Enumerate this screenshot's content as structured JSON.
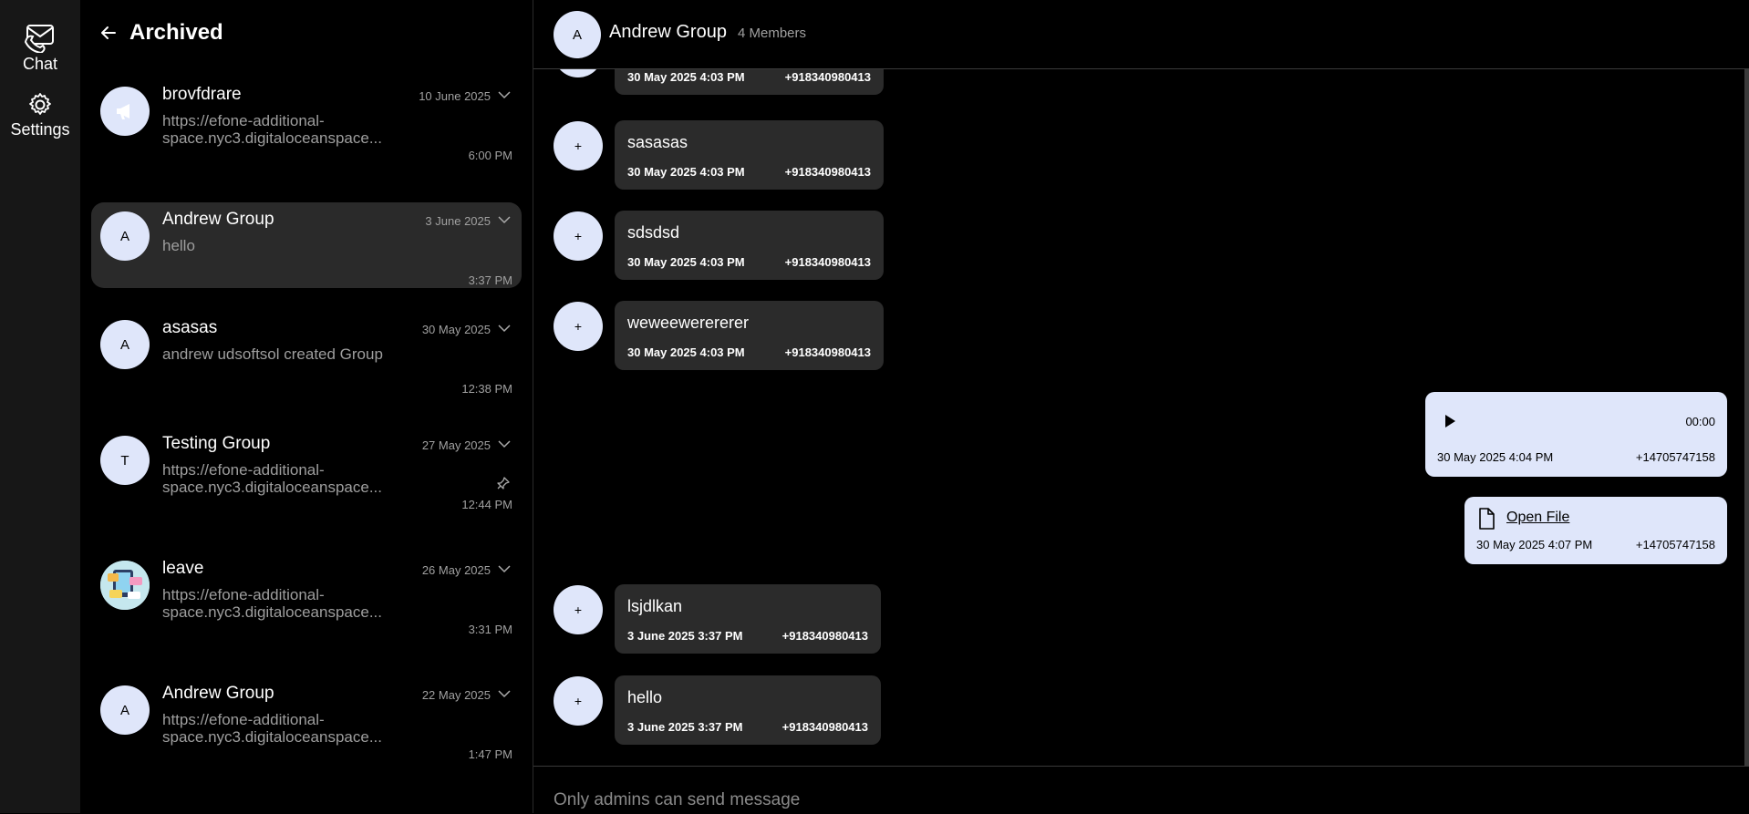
{
  "nav": {
    "items": [
      {
        "label": "Chat",
        "icon": "chat-icon"
      },
      {
        "label": "Settings",
        "icon": "gear-icon"
      }
    ]
  },
  "list": {
    "title": "Archived",
    "conversations": [
      {
        "avatar": "",
        "avatar_icon": "megaphone-icon",
        "name": "brovfdrare",
        "date": "10 June 2025",
        "preview1": "https://efone-additional-",
        "preview2": "space.nyc3.digitaloceanspace...",
        "time": "6:00 PM",
        "pinned": false,
        "active": false
      },
      {
        "avatar": "A",
        "name": "Andrew Group",
        "date": "3 June 2025",
        "preview1": "hello",
        "preview2": "",
        "time": "3:37 PM",
        "pinned": false,
        "active": true
      },
      {
        "avatar": "A",
        "name": "asasas",
        "date": "30 May 2025",
        "preview1": "andrew udsoftsol created Group",
        "preview2": "",
        "time": "12:38 PM",
        "pinned": false,
        "active": false
      },
      {
        "avatar": "T",
        "name": "Testing Group",
        "date": "27 May 2025",
        "preview1": "https://efone-additional-",
        "preview2": "space.nyc3.digitaloceanspace...",
        "time": "12:44 PM",
        "pinned": true,
        "active": false
      },
      {
        "avatar": "",
        "avatar_icon": "group-photo-avatar",
        "name": "leave",
        "date": "26 May 2025",
        "preview1": "https://efone-additional-",
        "preview2": "space.nyc3.digitaloceanspace...",
        "time": "3:31 PM",
        "pinned": false,
        "active": false
      },
      {
        "avatar": "A",
        "name": "Andrew Group",
        "date": "22 May 2025",
        "preview1": "https://efone-additional-",
        "preview2": "space.nyc3.digitaloceanspace...",
        "time": "1:47 PM",
        "pinned": false,
        "active": false
      }
    ]
  },
  "chat": {
    "avatar": "A",
    "title": "Andrew Group",
    "members": "4 Members",
    "messages": [
      {
        "text": "",
        "time": "30 May 2025 4:03 PM",
        "sender": "+918340980413"
      },
      {
        "text": "sasasas",
        "time": "30 May 2025 4:03 PM",
        "sender": "+918340980413"
      },
      {
        "text": "sdsdsd",
        "time": "30 May 2025 4:03 PM",
        "sender": "+918340980413"
      },
      {
        "text": "weweewerererer",
        "time": "30 May 2025 4:03 PM",
        "sender": "+918340980413"
      },
      {
        "text": "lsjdlkan",
        "time": "3 June 2025 3:37 PM",
        "sender": "+918340980413"
      },
      {
        "text": "hello",
        "time": "3 June 2025 3:37 PM",
        "sender": "+918340980413"
      }
    ],
    "avatar_symbol": "+",
    "audio": {
      "duration": "00:00",
      "time": "30 May 2025 4:04 PM",
      "sender": "+14705747158"
    },
    "file": {
      "label": "Open File",
      "time": "30 May 2025 4:07 PM",
      "sender": "+14705747158"
    },
    "footer_notice": "Only admins can send message"
  },
  "colors": {
    "accent_light": "#dfe6fa",
    "panel": "#2b2b2b",
    "rail": "#171717"
  }
}
